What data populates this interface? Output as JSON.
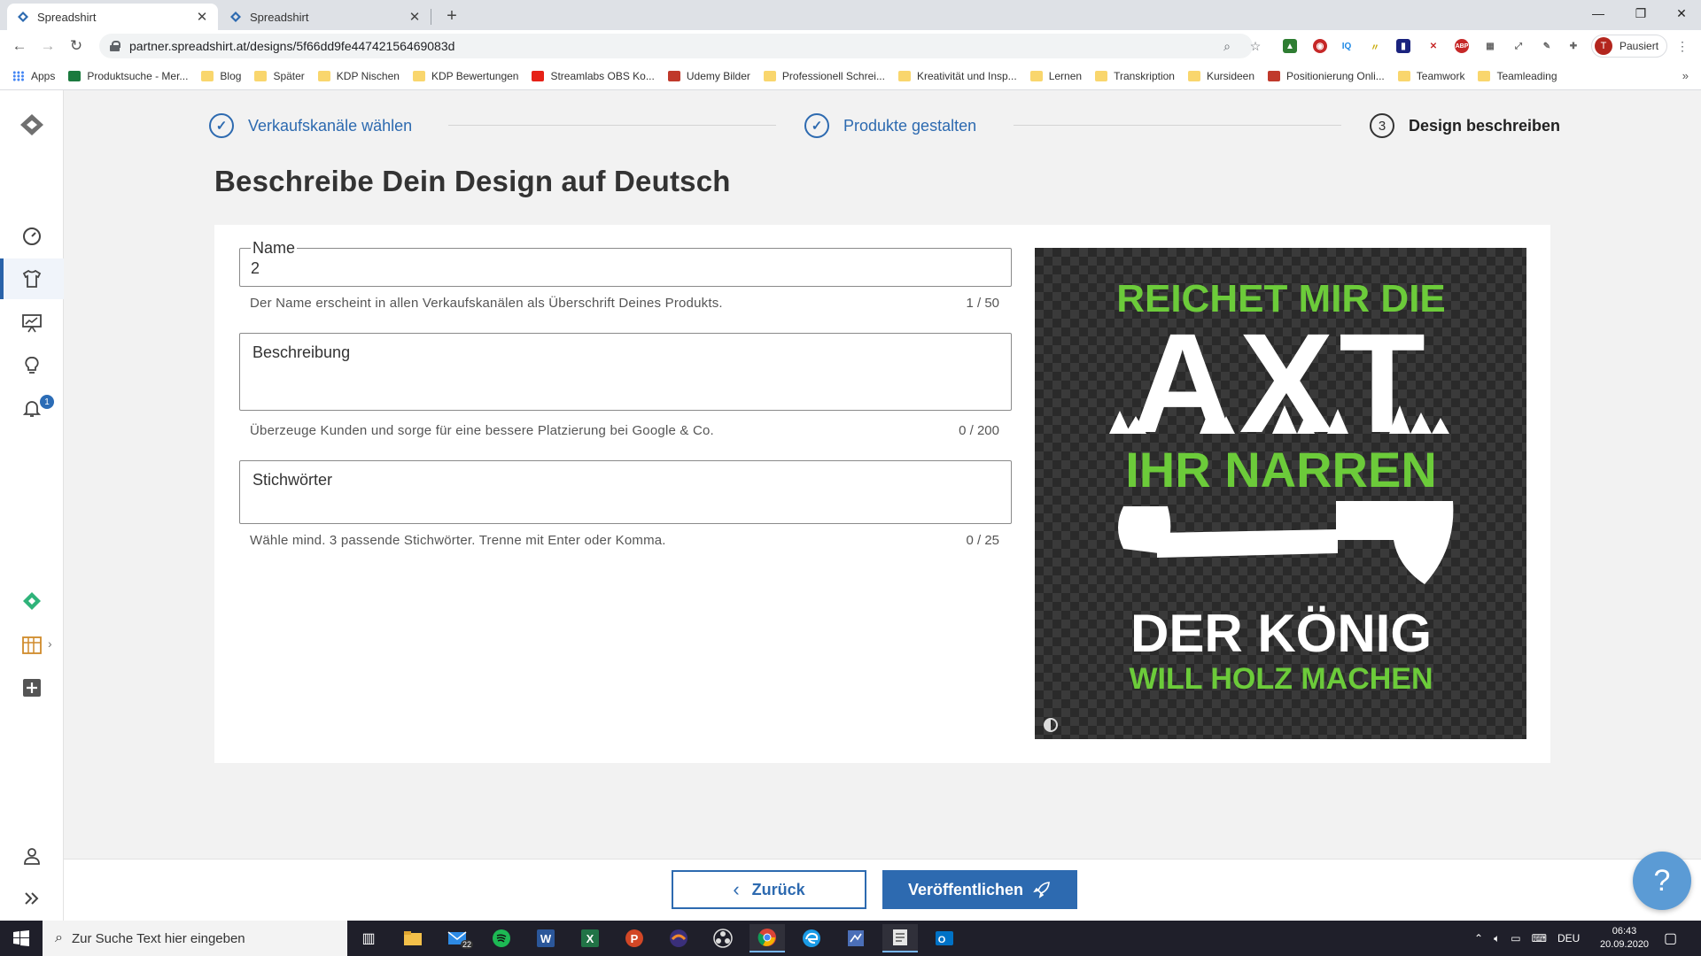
{
  "browser": {
    "tabs": [
      {
        "title": "Spreadshirt",
        "active": true
      },
      {
        "title": "Spreadshirt",
        "active": false
      }
    ],
    "url": "partner.spreadshirt.at/designs/5f66dd9fe44742156469083d",
    "profile_label": "Pausiert",
    "profile_initial": "T",
    "bookmarks": [
      {
        "label": "Apps",
        "type": "apps"
      },
      {
        "label": "Produktsuche - Mer...",
        "type": "site",
        "color": "#1b7a3e"
      },
      {
        "label": "Blog",
        "type": "folder"
      },
      {
        "label": "Später",
        "type": "folder"
      },
      {
        "label": "KDP Nischen",
        "type": "folder"
      },
      {
        "label": "KDP Bewertungen",
        "type": "folder"
      },
      {
        "label": "Streamlabs OBS Ko...",
        "type": "site",
        "color": "#e62117"
      },
      {
        "label": "Udemy Bilder",
        "type": "site",
        "color": "#c0392b"
      },
      {
        "label": "Professionell Schrei...",
        "type": "folder"
      },
      {
        "label": "Kreativität und Insp...",
        "type": "folder"
      },
      {
        "label": "Lernen",
        "type": "folder"
      },
      {
        "label": "Transkription",
        "type": "folder"
      },
      {
        "label": "Kursideen",
        "type": "folder"
      },
      {
        "label": "Positionierung Onli...",
        "type": "site",
        "color": "#c0392b"
      },
      {
        "label": "Teamwork",
        "type": "folder"
      },
      {
        "label": "Teamleading",
        "type": "folder"
      }
    ]
  },
  "stepper": {
    "steps": [
      {
        "label": "Verkaufskanäle wählen",
        "state": "done",
        "mark": "✓"
      },
      {
        "label": "Produkte gestalten",
        "state": "done",
        "mark": "✓"
      },
      {
        "label": "Design beschreiben",
        "state": "current",
        "mark": "3"
      }
    ]
  },
  "page": {
    "title": "Beschreibe Dein Design auf Deutsch"
  },
  "form": {
    "name": {
      "label": "Name",
      "value": "2",
      "hint": "Der Name erscheint in allen Verkaufskanälen als Überschrift Deines Produkts.",
      "count": "1 / 50"
    },
    "description": {
      "label": "Beschreibung",
      "hint": "Überzeuge Kunden und sorge für eine bessere Platzierung bei Google & Co.",
      "count": "0 / 200"
    },
    "keywords": {
      "label": "Stichwörter",
      "hint": "Wähle mind. 3 passende Stichwörter. Trenne mit Enter oder Komma.",
      "count": "0 / 25"
    }
  },
  "design_preview": {
    "lines": [
      "REICHET MIR DIE",
      "AXT",
      "IHR NARREN",
      "DER KÖNIG",
      "WILL HOLZ MACHEN"
    ],
    "green": "#6ccb3a",
    "white": "#ffffff"
  },
  "footer": {
    "back_label": "Zurück",
    "publish_label": "Veröffentlichen",
    "help_label": "?"
  },
  "taskbar": {
    "search_placeholder": "Zur Suche Text hier eingeben",
    "mail_badge": "22",
    "language": "DEU",
    "time": "06:43",
    "date": "20.09.2020"
  },
  "colors": {
    "accent": "#2d6ab0",
    "background": "#f2f2f2"
  }
}
